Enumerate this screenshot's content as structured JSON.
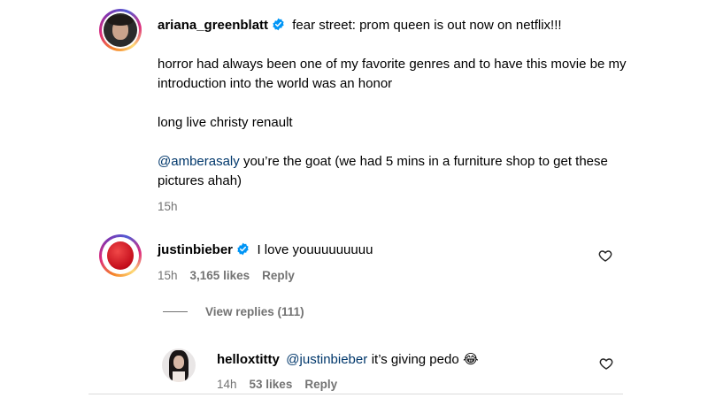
{
  "post": {
    "username": "ariana_greenblatt",
    "caption_first_line": "fear street: prom queen is out now on netflix!!!",
    "caption_para_1": "horror had always been one of my favorite genres and to have this movie be my introduction into the world was an honor",
    "caption_para_2": "long live christy renault",
    "caption_mention": "@amberasaly",
    "caption_para_3": "you’re the goat (we had 5 mins in a furniture shop to get these pictures ahah)",
    "time": "15h"
  },
  "comment": {
    "username": "justinbieber",
    "text": "I love youuuuuuuuu",
    "time": "15h",
    "likes": "3,165 likes",
    "reply_label": "Reply",
    "view_replies": "View replies (111)"
  },
  "reply": {
    "username": "helloxtitty",
    "mention": "@justinbieber",
    "text": "it’s giving pedo",
    "emoji": "😂",
    "time": "14h",
    "likes": "53 likes",
    "reply_label": "Reply"
  },
  "colors": {
    "verified": "#0095f6",
    "mention": "#00376b",
    "meta": "#737373"
  }
}
